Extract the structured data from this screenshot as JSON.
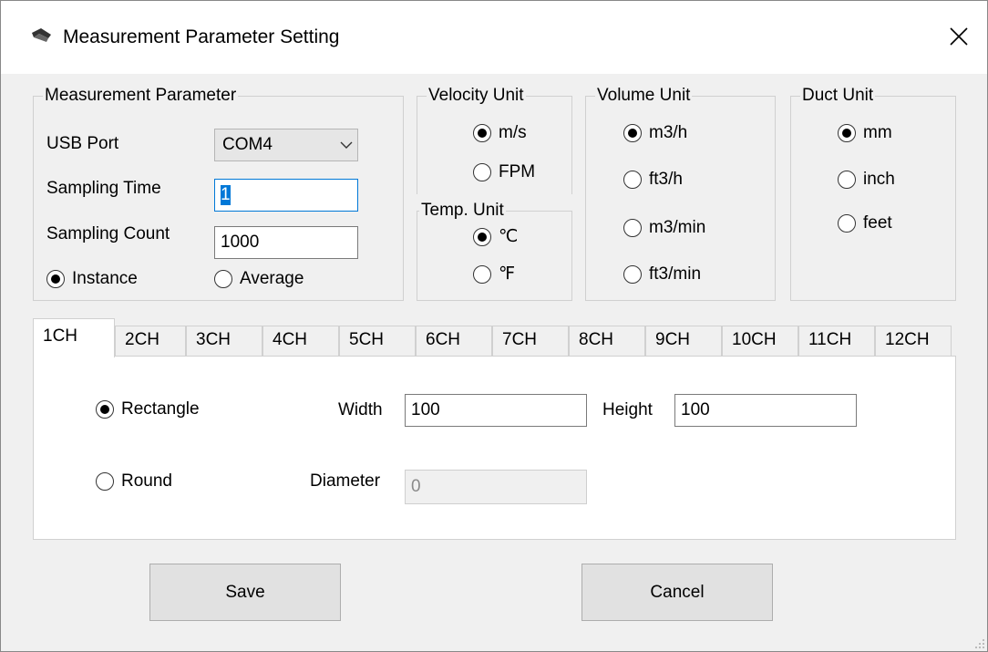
{
  "window": {
    "title": "Measurement Parameter Setting",
    "icon": "sensor-probe-icon",
    "close_icon": "close-icon"
  },
  "measurement_parameter": {
    "legend": "Measurement Parameter",
    "usb_port_label": "USB Port",
    "usb_port_value": "COM4",
    "sampling_time_label": "Sampling Time",
    "sampling_time_value": "1",
    "sampling_count_label": "Sampling Count",
    "sampling_count_value": "1000",
    "mode_options": [
      {
        "label": "Instance",
        "checked": true
      },
      {
        "label": "Average",
        "checked": false
      }
    ]
  },
  "velocity_unit": {
    "legend": "Velocity Unit",
    "options": [
      {
        "label": "m/s",
        "checked": true
      },
      {
        "label": "FPM",
        "checked": false
      }
    ]
  },
  "temp_unit": {
    "legend": "Temp. Unit",
    "options": [
      {
        "label": "℃",
        "checked": true
      },
      {
        "label": "℉",
        "checked": false
      }
    ]
  },
  "volume_unit": {
    "legend": "Volume Unit",
    "options": [
      {
        "label": "m3/h",
        "checked": true
      },
      {
        "label": "ft3/h",
        "checked": false
      },
      {
        "label": "m3/min",
        "checked": false
      },
      {
        "label": "ft3/min",
        "checked": false
      }
    ]
  },
  "duct_unit": {
    "legend": "Duct Unit",
    "options": [
      {
        "label": "mm",
        "checked": true
      },
      {
        "label": "inch",
        "checked": false
      },
      {
        "label": "feet",
        "checked": false
      }
    ]
  },
  "tabs": [
    "1CH",
    "2CH",
    "3CH",
    "4CH",
    "5CH",
    "6CH",
    "7CH",
    "8CH",
    "9CH",
    "10CH",
    "11CH",
    "12CH"
  ],
  "active_tab": "1CH",
  "channel": {
    "shape_options": [
      {
        "label": "Rectangle",
        "checked": true
      },
      {
        "label": "Round",
        "checked": false
      }
    ],
    "width_label": "Width",
    "width_value": "100",
    "height_label": "Height",
    "height_value": "100",
    "diameter_label": "Diameter",
    "diameter_value": "0"
  },
  "buttons": {
    "save": "Save",
    "cancel": "Cancel"
  },
  "colors": {
    "window_bg": "#f0f0f0",
    "focus_border": "#0078d7",
    "button_bg": "#e1e1e1"
  }
}
